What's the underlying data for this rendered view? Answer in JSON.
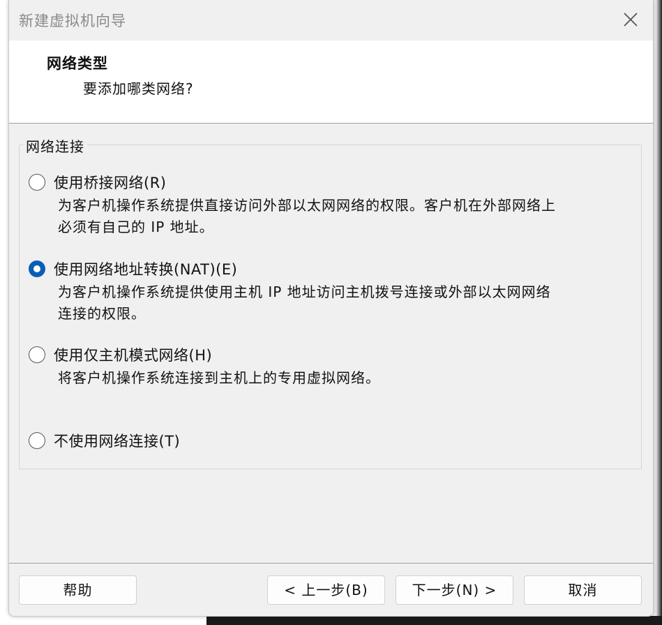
{
  "window": {
    "title": "新建虚拟机向导"
  },
  "header": {
    "title": "网络类型",
    "subtitle": "要添加哪类网络?"
  },
  "network_group": {
    "legend": "网络连接",
    "options": [
      {
        "label": "使用桥接网络(R)",
        "description_lines": [
          "为客户机操作系统提供直接访问外部以太网网络的权限。客户机在外部网络上",
          "必须有自己的 IP 地址。"
        ],
        "selected": false
      },
      {
        "label": "使用网络地址转换(NAT)(E)",
        "description_lines": [
          "为客户机操作系统提供使用主机 IP 地址访问主机拨号连接或外部以太网网络",
          "连接的权限。"
        ],
        "selected": true
      },
      {
        "label": "使用仅主机模式网络(H)",
        "description_lines": [
          "将客户机操作系统连接到主机上的专用虚拟网络。"
        ],
        "selected": false
      },
      {
        "label": "不使用网络连接(T)",
        "description_lines": [],
        "selected": false
      }
    ]
  },
  "footer": {
    "help_label": "帮助",
    "back_label": "< 上一步(B)",
    "next_label": "下一步(N) >",
    "cancel_label": "取消"
  },
  "colors": {
    "dialog_bg": "#f0f0f0",
    "header_bg": "#ffffff",
    "radio_selected": "#0a5fb4",
    "title_text": "#8a8a8a"
  },
  "icons": {
    "close": "close-icon"
  }
}
